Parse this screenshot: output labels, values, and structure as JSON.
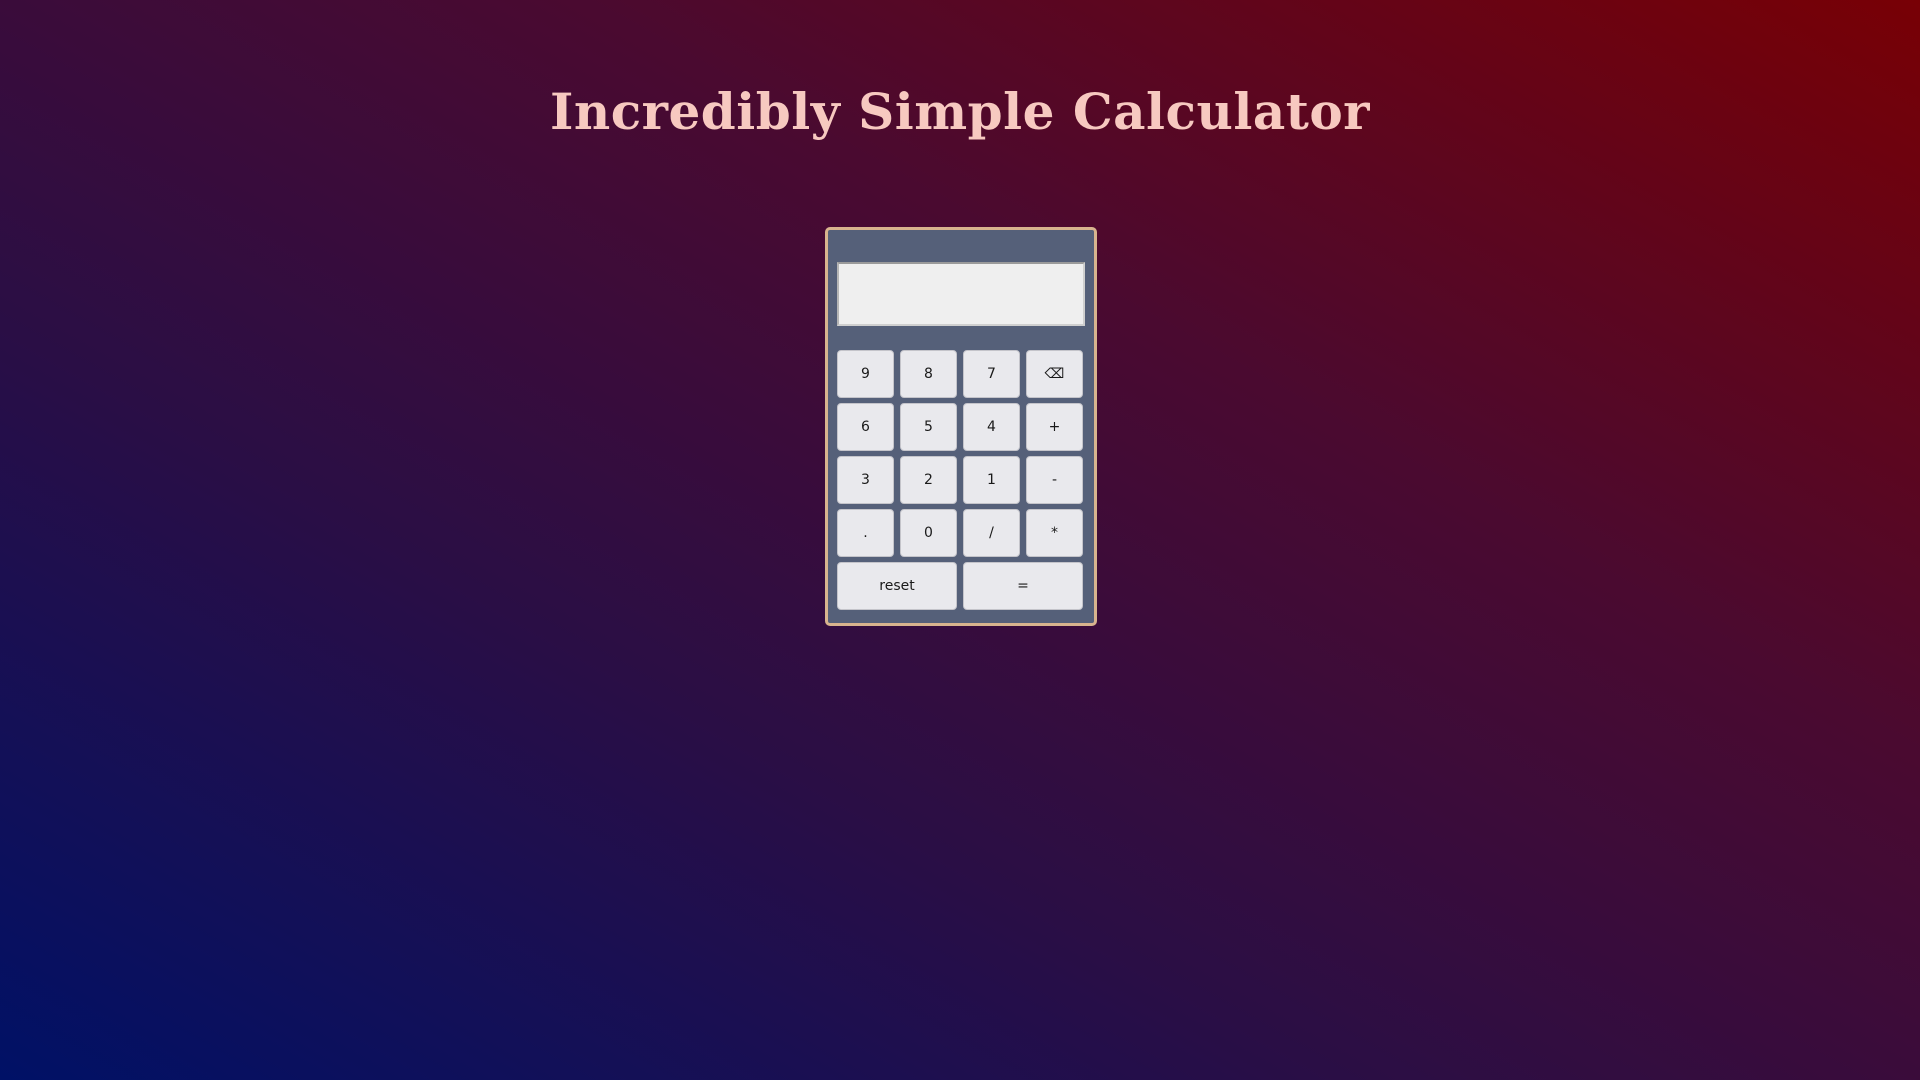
{
  "page": {
    "title": "Incredibly Simple Calculator"
  },
  "calculator": {
    "display_value": "",
    "keys": {
      "k9": "9",
      "k8": "8",
      "k7": "7",
      "backspace": "⌫",
      "k6": "6",
      "k5": "5",
      "k4": "4",
      "plus": "+",
      "k3": "3",
      "k2": "2",
      "k1": "1",
      "minus": "-",
      "dot": ".",
      "k0": "0",
      "divide": "/",
      "multiply": "*",
      "reset": "reset",
      "equals": "="
    }
  },
  "colors": {
    "title": "#f7c9c0",
    "calculator_body": "#556079",
    "calculator_border": "#d8b48e",
    "display_bg": "#efefef",
    "key_bg": "#e9e9ed",
    "gradient_start": "#001166",
    "gradient_end": "#780005"
  }
}
